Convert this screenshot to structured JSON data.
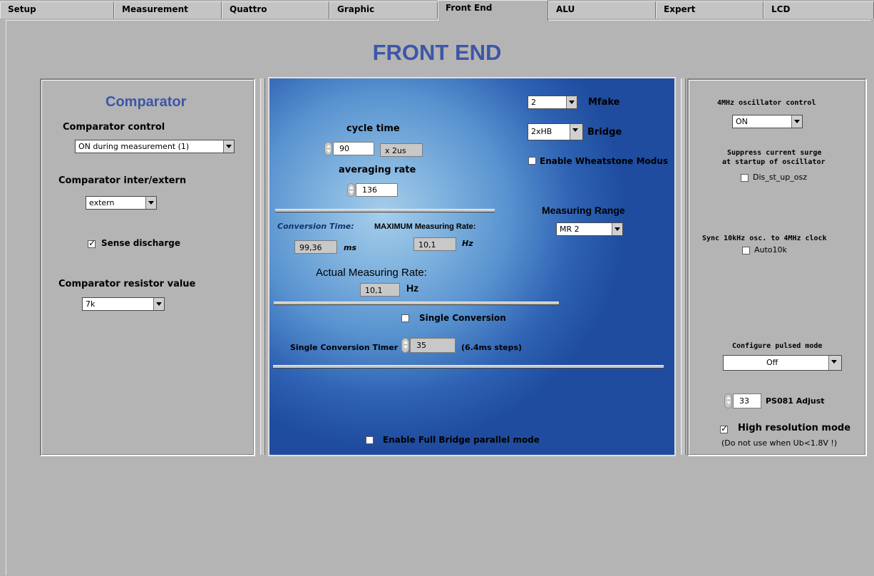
{
  "tabs": [
    "Setup",
    "Measurement",
    "Quattro",
    "Graphic",
    "Front End",
    "ALU",
    "Expert",
    "LCD"
  ],
  "active_tab": "Front End",
  "page_title": "FRONT END",
  "left": {
    "title": "Comparator",
    "comparator_control_label": "Comparator control",
    "comparator_control_value": "ON during measurement (1)",
    "inter_extern_label": "Comparator inter/extern",
    "inter_extern_value": "extern",
    "sense_discharge_label": "Sense discharge",
    "sense_discharge_checked": true,
    "resistor_label": "Comparator resistor value",
    "resistor_value": "7k"
  },
  "center": {
    "cycle_time_label": "cycle time",
    "cycle_time_value": "90",
    "cycle_time_unit": "x 2us",
    "averaging_rate_label": "averaging rate",
    "averaging_rate_value": "136",
    "mfake_value": "2",
    "mfake_label": "Mfake",
    "bridge_value": "2xHB",
    "bridge_label": "Bridge",
    "wheatstone_label": "Enable Wheatstone Modus",
    "wheatstone_checked": false,
    "measuring_range_label": "Measuring Range",
    "measuring_range_value": "MR 2",
    "conversion_time_label": "Conversion Time:",
    "conversion_time_value": "99,36",
    "conversion_time_unit": "ms",
    "max_rate_label": "MAXIMUM Measuring Rate:",
    "max_rate_value": "10,1",
    "max_rate_unit": "Hz",
    "actual_rate_label": "Actual Measuring Rate:",
    "actual_rate_value": "10,1",
    "actual_rate_unit": "Hz",
    "single_conversion_label": "Single Conversion",
    "single_conversion_checked": false,
    "single_timer_label": "Single Conversion Timer",
    "single_timer_value": "35",
    "single_timer_unit": "(6.4ms steps)",
    "full_bridge_label": "Enable Full Bridge parallel mode",
    "full_bridge_checked": false
  },
  "right": {
    "osc_label": "4MHz oscillator control",
    "osc_value": "ON",
    "suppress_line1": "Suppress current surge",
    "suppress_line2": "at startup of oscillator",
    "dis_st_label": "Dis_st_up_osz",
    "dis_st_checked": false,
    "sync_label": "Sync 10kHz osc. to 4MHz clock",
    "auto10k_label": "Auto10k",
    "auto10k_checked": false,
    "pulsed_label": "Configure pulsed mode",
    "pulsed_value": "Off",
    "ps081_value": "33",
    "ps081_label": "PS081 Adjust",
    "high_res_label": "High resolution mode",
    "high_res_checked": true,
    "high_res_note": "(Do not use when Ub<1.8V !)"
  }
}
